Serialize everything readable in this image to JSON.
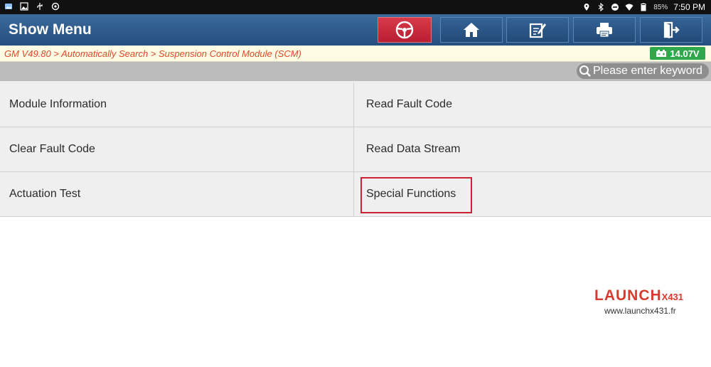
{
  "status": {
    "battery": "85%",
    "time": "7:50 PM"
  },
  "header": {
    "title": "Show Menu",
    "buttons": [
      "car-diagnostic",
      "home",
      "edit-report",
      "print",
      "exit"
    ]
  },
  "breadcrumb": {
    "text": "GM V49.80 > Automatically Search > Suspension Control Module (SCM)",
    "voltage": "14.07V"
  },
  "search": {
    "placeholder": "Please enter keyword"
  },
  "menu": {
    "items": [
      "Module Information",
      "Read Fault Code",
      "Clear Fault Code",
      "Read Data Stream",
      "Actuation Test",
      "Special Functions"
    ],
    "highlighted": "Special Functions"
  },
  "watermark": {
    "brand": "LAUNCH",
    "model": "X431",
    "url": "www.launchx431.fr"
  },
  "colors": {
    "header": "#2e5b8c",
    "accent_red": "#cc2233",
    "voltage_badge": "#2ea84a",
    "crumb_text": "#d84a2a"
  }
}
